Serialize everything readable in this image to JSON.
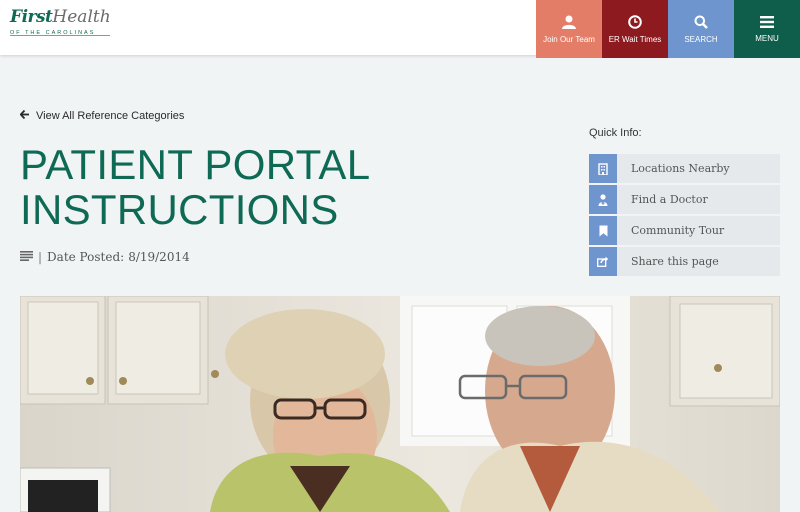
{
  "header": {
    "logo": {
      "first": "First",
      "health": "Health",
      "tagline": "OF THE CAROLINAS"
    },
    "nav": [
      {
        "label": "Join Our Team",
        "icon": "person-icon",
        "color": "#e47d67"
      },
      {
        "label": "ER Wait Times",
        "icon": "clock-icon",
        "color": "#8c1a1f"
      },
      {
        "label": "SEARCH",
        "icon": "search-icon",
        "color": "#6f95cf"
      },
      {
        "label": "MENU",
        "icon": "menu-icon",
        "color": "#0f5e4c"
      }
    ]
  },
  "back_link": {
    "label": "View All Reference Categories",
    "icon": "arrow-left-icon"
  },
  "page": {
    "title_line1": "PATIENT PORTAL",
    "title_line2": "INSTRUCTIONS",
    "meta": {
      "separator": "|",
      "label": "Date Posted:",
      "date": "8/19/2014",
      "icon": "lines-icon"
    }
  },
  "quick_info": {
    "title": "Quick Info:",
    "items": [
      {
        "label": "Locations Nearby",
        "icon": "building-icon"
      },
      {
        "label": "Find a Doctor",
        "icon": "doctor-icon"
      },
      {
        "label": "Community Tour",
        "icon": "bookmark-icon"
      },
      {
        "label": "Share this page",
        "icon": "share-icon"
      }
    ]
  },
  "colors": {
    "brand_green": "#0f6a55",
    "accent_blue": "#6f95cf",
    "accent_salmon": "#e47d67",
    "accent_red": "#8c1a1f",
    "page_background": "#f1f4f5"
  }
}
